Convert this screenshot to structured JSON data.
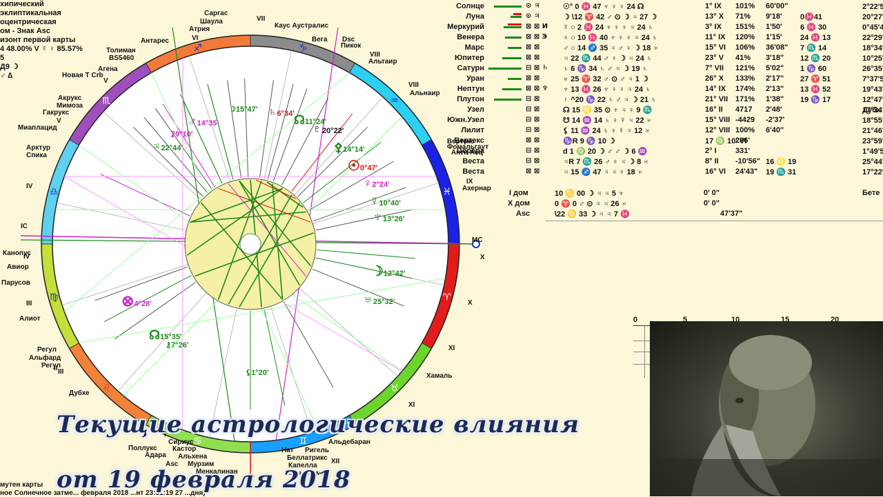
{
  "left_info": [
    "хипический",
    "эклиптикальная",
    "оцентрическая",
    "ом - Знак Asc",
    "изонт первой карты",
    "4 48.00% V ☿ ♀ 85.57%",
    "5",
    "Д9 ☽",
    "♂ ∆"
  ],
  "fixed_stars": [
    {
      "id": "sargas",
      "label": "Саргас"
    },
    {
      "id": "shaula",
      "label": "Шаула"
    },
    {
      "id": "atria",
      "label": "Атрия"
    },
    {
      "id": "antares",
      "label": "Антарес"
    },
    {
      "id": "tolimen",
      "label": "Толиман"
    },
    {
      "id": "bs5460",
      "label": "BS5460"
    },
    {
      "id": "agena",
      "label": "Агена"
    },
    {
      "id": "novaya",
      "label": "Новая Т Crb"
    },
    {
      "id": "akrukus",
      "label": "Акрукс"
    },
    {
      "id": "mimoza",
      "label": "Мимоза"
    },
    {
      "id": "gakrukus",
      "label": "Гакрукс"
    },
    {
      "id": "miaplacid",
      "label": "Миаплацид"
    },
    {
      "id": "arktur",
      "label": "Арктур"
    },
    {
      "id": "spika",
      "label": "Спика"
    },
    {
      "id": "kaus",
      "label": "Каус Аустралис"
    },
    {
      "id": "vega",
      "label": "Вега"
    },
    {
      "id": "dsc",
      "label": "Dsc"
    },
    {
      "id": "peacock",
      "label": "Пикок"
    },
    {
      "id": "altair",
      "label": "Альтаир"
    },
    {
      "id": "alnair",
      "label": "Альнаир"
    },
    {
      "id": "fomalhaut",
      "label": "Фомальгаут"
    },
    {
      "id": "vertex",
      "label": "Вертекс"
    },
    {
      "id": "anti",
      "label": "Анти Асц"
    },
    {
      "id": "achernar",
      "label": "Ахернар"
    },
    {
      "id": "canopus",
      "label": "Канопус"
    },
    {
      "id": "avior",
      "label": "Авиор"
    },
    {
      "id": "parusov",
      "label": "Парусов"
    },
    {
      "id": "aliot",
      "label": "Алиот"
    },
    {
      "id": "regul",
      "label": "Регул"
    },
    {
      "id": "alfard",
      "label": "Альфард"
    },
    {
      "id": "regul2",
      "label": "Регул"
    },
    {
      "id": "dubhe",
      "label": "Дубхе"
    },
    {
      "id": "hamal",
      "label": "Хамаль"
    },
    {
      "id": "aldebaran",
      "label": "Альдебаран"
    },
    {
      "id": "nat",
      "label": "Нат"
    },
    {
      "id": "rigel",
      "label": "Ригель"
    },
    {
      "id": "bellatrix",
      "label": "Беллатрикс"
    },
    {
      "id": "kapella",
      "label": "Капелла"
    },
    {
      "id": "alnilam",
      "label": "Альнилам"
    },
    {
      "id": "polluks",
      "label": "Поллукс"
    },
    {
      "id": "sirius",
      "label": "Сириус"
    },
    {
      "id": "adara",
      "label": "Адара"
    },
    {
      "id": "alhena",
      "label": "Альхена"
    },
    {
      "id": "murzim",
      "label": "Мурзим"
    },
    {
      "id": "menkalinan",
      "label": "Менкалинан"
    },
    {
      "id": "kastor",
      "label": "Кастор"
    },
    {
      "id": "asc",
      "label": "Asc"
    }
  ],
  "houses": [
    "VII",
    "VIII",
    "VIII",
    "IX",
    "X",
    "X",
    "XI",
    "XI",
    "XII",
    "I",
    "II",
    "III",
    "III",
    "IV",
    "IV",
    "V",
    "V",
    "VI",
    "IC",
    "MC",
    "X"
  ],
  "planet_labels": [
    {
      "id": "saturn",
      "glyph": "♄",
      "deg": "6°34'",
      "color": "#c02020"
    },
    {
      "id": "moon-n",
      "glyph": "☽",
      "deg": "15°47'",
      "color": "#1a8a1a"
    },
    {
      "id": "mars",
      "glyph": "♂",
      "deg": "14°35'",
      "color": "#d01fd0"
    },
    {
      "id": "ceres",
      "glyph": "⚳",
      "deg": "9°10'",
      "color": "#d01fd0"
    },
    {
      "id": "jupiter",
      "glyph": "♃",
      "deg": "22°44'",
      "color": "#1a8a1a"
    },
    {
      "id": "node",
      "glyph": "☊",
      "deg": "11°24'",
      "color": "#1a8a1a"
    },
    {
      "id": "pluto",
      "glyph": "♇",
      "deg": "20°22'",
      "color": "#111"
    },
    {
      "id": "pallas",
      "glyph": "⚴",
      "deg": "14°14'",
      "color": "#1a8a1a"
    },
    {
      "id": "sun",
      "glyph": "☉",
      "deg": "0°47'",
      "color": "#d11"
    },
    {
      "id": "venus",
      "glyph": "♀",
      "deg": "2°24'",
      "color": "#d01fd0"
    },
    {
      "id": "mercury",
      "glyph": "☿",
      "deg": "10°40'",
      "color": "#1a8a1a"
    },
    {
      "id": "neptune",
      "glyph": "♆",
      "deg": "13°26'",
      "color": "#1a8a1a"
    },
    {
      "id": "moon",
      "glyph": "☽",
      "deg": "12°42'",
      "color": "#1a8a1a"
    },
    {
      "id": "uranus",
      "glyph": "♅",
      "deg": "25°32'",
      "color": "#1a8a1a"
    },
    {
      "id": "fortune",
      "glyph": "⊗",
      "deg": "4°28'",
      "color": "#d01fd0"
    },
    {
      "id": "nnode",
      "glyph": "☊",
      "deg": "15°35'",
      "color": "#1a8a1a"
    },
    {
      "id": "chiron",
      "glyph": "⚷",
      "deg": "7°26'",
      "color": "#1a8a1a"
    },
    {
      "id": "lilith",
      "glyph": "⚸",
      "deg": "1°20'",
      "color": "#1a8a1a"
    }
  ],
  "table": [
    {
      "name": "Солнце",
      "glyphs": "⊙ ♃",
      "pos": "☉° 0 ♓ 47  ♆  ♀   ♀  24  ☊",
      "house": "1° IX",
      "pct": "101%",
      "speed": "60'00\"",
      "ext": "",
      "dec": "",
      "extra": "2°22'51\" ♉",
      "bar": 40,
      "bar2": 0
    },
    {
      "name": "Луна",
      "glyphs": "⊙ ♃",
      "pos": "☽ \\12 ♈ 42 ♂  ⊙  ☽  ♃  27  ☽",
      "house": "13° X",
      "pct": "71%",
      "speed": "9'18'",
      "ext": "0♓41",
      "dec": "",
      "extra": "20°27'48\" ♓",
      "bar": 16,
      "bar2": 12
    },
    {
      "name": "Меркурий",
      "glyphs": "⊠ ⊠ И",
      "pos": "☿ ○ 2 ♓ 24  ♆  ♀  ♀  ♃  24  ♄",
      "house": "3° IX",
      "pct": "151%",
      "speed": "1'50'",
      "ext": "6 ♓ 30",
      "dec": "",
      "extra": "0°45'49\" ♉",
      "bar": 26,
      "bar2": 20
    },
    {
      "name": "Венера",
      "glyphs": "⊠ ⊠ Э",
      "pos": "♀ ○ 10 ♓ 40  ♆  ♀  ♀  ♃  24  ♄",
      "house": "11° IX",
      "pct": "120%",
      "speed": "1'15'",
      "ext": "24 ♓ 13",
      "dec": "",
      "extra": "22°29'29\" ♈",
      "bar": 24,
      "bar2": 0
    },
    {
      "name": "Марс",
      "glyphs": "⊠ ⊠",
      "pos": "♂ ○ 14 ♐ 35  ♃  ♂  ♀  ☽  18  ♅",
      "house": "15° VI",
      "pct": "106%",
      "speed": "36'08\"",
      "ext": "7 ♏ 14",
      "dec": "",
      "extra": "18°34'52\" ♋",
      "bar": 20,
      "bar2": 0
    },
    {
      "name": "Юпитер",
      "glyphs": "⊠ ⊠",
      "pos": "♃  22 ♏ 44  ♂  ♀  ☽  ♃  24  ♄",
      "house": "23° V",
      "pct": "41%",
      "speed": "3'18\"",
      "ext": "12 ♏ 20",
      "dec": "",
      "extra": "10°25'27\" ♋",
      "bar": 28,
      "bar2": 0
    },
    {
      "name": "Сатурн",
      "glyphs": "⊟ ⊠ ♄",
      "pos": "♄  6 ♑ 34  ♄  ♂  ♃  ☽  19  ♄",
      "house": "7° VII",
      "pct": "121%",
      "speed": "5'02\"",
      "ext": "1 ♑ 60",
      "dec": "",
      "extra": "26°35'46\" ♑",
      "bar": 48,
      "bar2": 0
    },
    {
      "name": "Уран",
      "glyphs": "⊠ ⊠",
      "pos": "♅  25 ♈ 32  ♂  ⊙  ♂  ♃  1  ☽",
      "house": "26° X",
      "pct": "133%",
      "speed": "2'17\"",
      "ext": "27 ♈ 51",
      "dec": "",
      "extra": "7°37'58\" ♓",
      "bar": 20,
      "bar2": 0
    },
    {
      "name": "Нептун",
      "glyphs": "⊠ ⊠ ♆",
      "pos": "♆  13 ♓ 26  ♆  ♀  ♀  ♃  24  ♄",
      "house": "14° IX",
      "pct": "174%",
      "speed": "2'13\"",
      "ext": "13 ♓ 52",
      "dec": "",
      "extra": "19°43'20\" ♈",
      "bar": 28,
      "bar2": 0
    },
    {
      "name": "Плутон",
      "glyphs": "⊟ ⊠",
      "pos": "♇  ^20 ♑ 22  ♄  ♂  ♃  ☽  21  ♄",
      "house": "21° VII",
      "pct": "171%",
      "speed": "1'38\"",
      "ext": "19 ♑ 17",
      "dec": "",
      "extra": "12°47'16\" ♑",
      "bar": 40,
      "bar2": 0
    },
    {
      "name": "Узел",
      "glyphs": "⊟ ⊠",
      "pos": "☊  15 ♌ 35  ⊙  ♆  ♃  ♀  9  ♏",
      "house": "16° II",
      "pct": "4717",
      "speed": "2'48'",
      "ext": "",
      "dec": "",
      "extra": "17°34'14\" ♏",
      "bar": 0,
      "bar2": 0
    },
    {
      "name": "Южн.Узел",
      "glyphs": "⊟ ⊠",
      "pos": "☋  14 ♒ 14  ♄  ♀  ☿  ♃  22  ♅",
      "house": "15° VIII",
      "pct": "-4429",
      "speed": "-2'37'",
      "ext": "",
      "dec": "",
      "extra": "18°55'47\" ♉",
      "bar": 0,
      "bar2": 0
    },
    {
      "name": "Лилит",
      "glyphs": "⊟ ⊠",
      "pos": "⚸  11 ♒ 24  ♄  ♀  ☿  ♃  12  ♅",
      "house": "12° VIII",
      "pct": "100%",
      "speed": "6'40\"",
      "ext": "",
      "dec": "",
      "extra": "21°46'11\" ♉",
      "bar": 0,
      "bar2": 0
    },
    {
      "name": "Вертекс",
      "glyphs": "⊠ ⊠",
      "pos": "♑R  9 ♑ 10  ☽",
      "house": "17 ♍ 10' VI",
      "pct": "286'",
      "speed": "",
      "ext": "",
      "dec": "",
      "extra": "23°59'16\" ♒",
      "bar": 0,
      "bar2": 0
    },
    {
      "name": "Церера",
      "glyphs": "⊟ ⊠",
      "pos": "d  1 ♍ 20  ☽  ♂  ♂  ☽  6  ♒",
      "house": "2° I",
      "pct": "331'",
      "speed": "",
      "ext": "",
      "dec": "",
      "extra": "1°49'51\" ♑",
      "bar": 0,
      "bar2": 0
    },
    {
      "name": "Веста",
      "glyphs": "⊟ ⊠",
      "pos": "♃R  7 ♏ 26  ♂  ♀  ♃  ☽  8  ♅",
      "house": "8° II",
      "pct": "-10'56\"",
      "speed": "16 ♌ 19",
      "ext": "",
      "dec": "",
      "extra": "25°44'10\" ♏",
      "bar": 0,
      "bar2": 0
    },
    {
      "name": "Веста",
      "glyphs": "⊠ ⊠",
      "pos": "♃  15 ♐ 47  ♃  ♃  ♀  18  ♅",
      "house": "16° VI",
      "pct": "24'43\"",
      "speed": "19 ♏ 31",
      "ext": "",
      "dec": "",
      "extra": "17°22'27\" ♈",
      "bar": 0,
      "bar2": 0
    }
  ],
  "house_rows": [
    {
      "name": "I дом",
      "pos": "10 ♋ 00  ☽  ♃  ♃  5  ♆",
      "deg": "0' 0\""
    },
    {
      "name": "X дом",
      "pos": "0 ♈ 0  ♂  ⊙  ♃  ♃  26  ♅",
      "deg": "0' 0\""
    },
    {
      "name": "Asc",
      "pos": "\\22 ♋ 33  ☽  ♃  ♃  7  ♓",
      "deg": "47'37\""
    }
  ],
  "right_edge": {
    "dub": "Дубх",
    "bete": "Бете"
  },
  "grid_axis": [
    "0",
    "5",
    "10",
    "15",
    "20"
  ],
  "caption": {
    "line1": "Текущие астрологические влияния",
    "line2": "от 19 февраля 2018"
  },
  "footer": {
    "line1": "мутен карты",
    "line2": "ное Солнечное затме... февраля 2018 ...нт 23:51:19 27 ...дня)"
  },
  "colors": {
    "background": "#fdf7d9",
    "green": "#1a8a1a",
    "magenta": "#d01fd0",
    "red": "#d11",
    "inner": "#f6f0a6"
  }
}
